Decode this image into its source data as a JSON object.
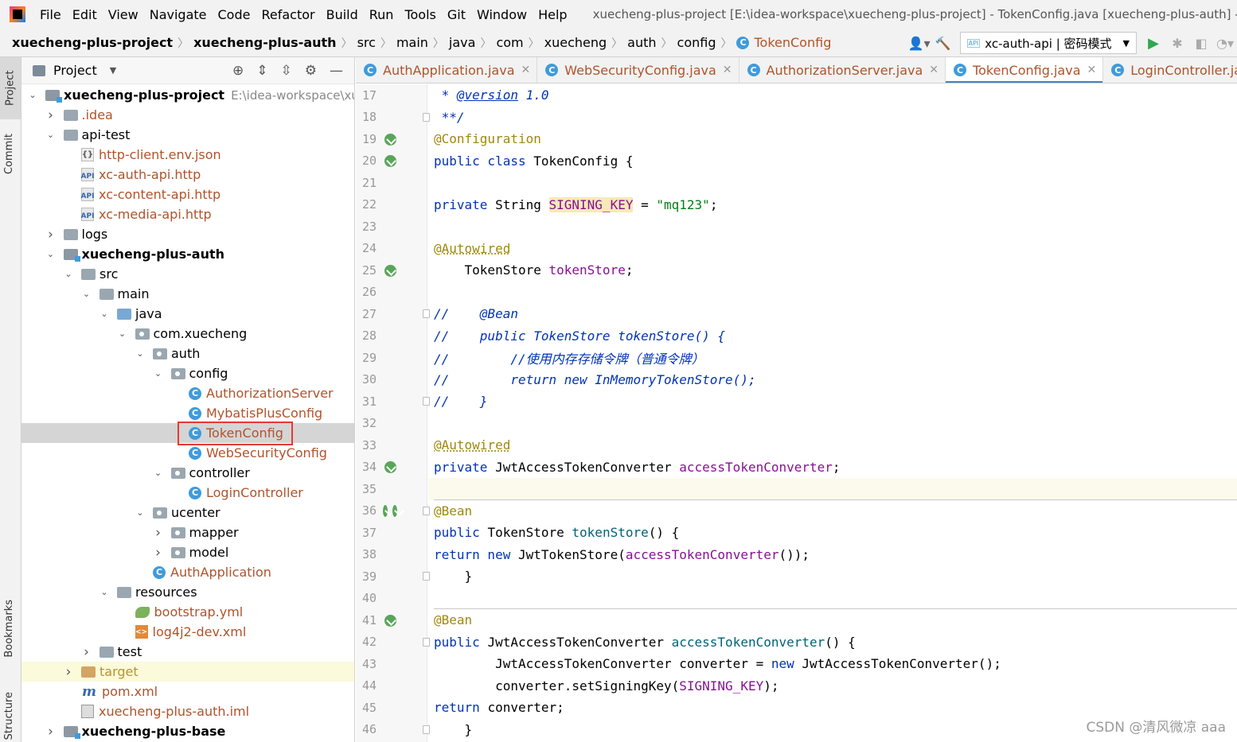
{
  "menu": {
    "items": [
      "File",
      "Edit",
      "View",
      "Navigate",
      "Code",
      "Refactor",
      "Build",
      "Run",
      "Tools",
      "Git",
      "Window",
      "Help"
    ],
    "window_title": "xuecheng-plus-project [E:\\idea-workspace\\xuecheng-plus-project] - TokenConfig.java [xuecheng-plus-auth] - A"
  },
  "breadcrumb": [
    "xuecheng-plus-project",
    "xuecheng-plus-auth",
    "src",
    "main",
    "java",
    "com",
    "xuecheng",
    "auth",
    "config",
    "TokenConfig"
  ],
  "toolbar": {
    "run_config": "xc-auth-api | 密码模式",
    "run_config_badge": "API"
  },
  "left_strip": [
    "Project",
    "Commit",
    "Bookmarks",
    "Structure"
  ],
  "project_panel": {
    "title": "Project",
    "tree": [
      {
        "label": "xuecheng-plus-project",
        "path": "E:\\idea-workspace\\xuecheng",
        "type": "module",
        "bold": true,
        "depth": 0,
        "open": true
      },
      {
        "label": ".idea",
        "type": "folder",
        "depth": 1,
        "open": false
      },
      {
        "label": "api-test",
        "type": "folder",
        "depth": 1,
        "open": true
      },
      {
        "label": "http-client.env.json",
        "type": "json",
        "depth": 2
      },
      {
        "label": "xc-auth-api.http",
        "type": "api",
        "depth": 2
      },
      {
        "label": "xc-content-api.http",
        "type": "api",
        "depth": 2
      },
      {
        "label": "xc-media-api.http",
        "type": "api",
        "depth": 2
      },
      {
        "label": "logs",
        "type": "folder",
        "depth": 1,
        "open": false
      },
      {
        "label": "xuecheng-plus-auth",
        "type": "module",
        "bold": true,
        "depth": 1,
        "open": true
      },
      {
        "label": "src",
        "type": "folder",
        "depth": 2,
        "open": true
      },
      {
        "label": "main",
        "type": "folder",
        "depth": 3,
        "open": true
      },
      {
        "label": "java",
        "type": "folder-blue",
        "depth": 4,
        "open": true
      },
      {
        "label": "com.xuecheng",
        "type": "package",
        "depth": 5,
        "open": true
      },
      {
        "label": "auth",
        "type": "package",
        "depth": 6,
        "open": true
      },
      {
        "label": "config",
        "type": "package",
        "depth": 7,
        "open": true
      },
      {
        "label": "AuthorizationServer",
        "type": "class",
        "depth": 8
      },
      {
        "label": "MybatisPlusConfig",
        "type": "class",
        "depth": 8
      },
      {
        "label": "TokenConfig",
        "type": "class",
        "depth": 8,
        "selected": true
      },
      {
        "label": "WebSecurityConfig",
        "type": "class",
        "depth": 8
      },
      {
        "label": "controller",
        "type": "package",
        "depth": 7,
        "open": true
      },
      {
        "label": "LoginController",
        "type": "class",
        "depth": 8
      },
      {
        "label": "ucenter",
        "type": "package",
        "depth": 6,
        "open": true
      },
      {
        "label": "mapper",
        "type": "package",
        "depth": 7,
        "open": false
      },
      {
        "label": "model",
        "type": "package",
        "depth": 7,
        "open": false
      },
      {
        "label": "AuthApplication",
        "type": "class",
        "depth": 6
      },
      {
        "label": "resources",
        "type": "resources",
        "depth": 4,
        "open": true
      },
      {
        "label": "bootstrap.yml",
        "type": "yml",
        "depth": 5
      },
      {
        "label": "log4j2-dev.xml",
        "type": "xml",
        "depth": 5
      },
      {
        "label": "test",
        "type": "folder",
        "depth": 3,
        "open": false
      },
      {
        "label": "target",
        "type": "target",
        "depth": 2,
        "open": false,
        "highlight": true
      },
      {
        "label": "pom.xml",
        "type": "pom",
        "depth": 2
      },
      {
        "label": "xuecheng-plus-auth.iml",
        "type": "iml",
        "depth": 2
      },
      {
        "label": "xuecheng-plus-base",
        "type": "module",
        "bold": true,
        "depth": 1,
        "open": false
      }
    ]
  },
  "editor": {
    "tabs": [
      {
        "label": "AuthApplication.java",
        "active": false
      },
      {
        "label": "WebSecurityConfig.java",
        "active": false
      },
      {
        "label": "AuthorizationServer.java",
        "active": false
      },
      {
        "label": "TokenConfig.java",
        "active": true
      },
      {
        "label": "LoginController.java",
        "active": false
      }
    ],
    "tab_overflow_badge": "API",
    "lines": [
      {
        "n": 17,
        "html": "<span class=\"cm\"> * </span><span class=\"cmtag\">@version</span><span class=\"cm\"> 1.0</span>"
      },
      {
        "n": 18,
        "html": "<span class=\"cm\"> **/</span>"
      },
      {
        "n": 19,
        "html": "<span class=\"an\">@Configuration</span>",
        "gutter": "bean"
      },
      {
        "n": 20,
        "html": "<span class=\"kw\">public class </span>TokenConfig {",
        "gutter": "bean"
      },
      {
        "n": 21,
        "html": ""
      },
      {
        "n": 22,
        "html": "    <span class=\"kw\">private </span>String <span class=\"sk\">SIGNING_KEY</span> = <span class=\"str\">\"mq123\"</span>;"
      },
      {
        "n": 23,
        "html": ""
      },
      {
        "n": 24,
        "html": "    <span class=\"anu\">@Autowired</span>"
      },
      {
        "n": 25,
        "html": "    TokenStore <span class=\"fld\">tokenStore</span>;",
        "gutter": "bean"
      },
      {
        "n": 26,
        "html": ""
      },
      {
        "n": 27,
        "html": "<span class=\"cmi\">//    @Bean</span>"
      },
      {
        "n": 28,
        "html": "<span class=\"cmi\">//    public TokenStore tokenStore() {</span>"
      },
      {
        "n": 29,
        "html": "<span class=\"cmi\">//        //使用内存存储令牌（普通令牌）</span>"
      },
      {
        "n": 30,
        "html": "<span class=\"cmi\">//        return new InMemoryTokenStore();</span>"
      },
      {
        "n": 31,
        "html": "<span class=\"cmi\">//    }</span>"
      },
      {
        "n": 32,
        "html": ""
      },
      {
        "n": 33,
        "html": "    <span class=\"anu\">@Autowired</span>"
      },
      {
        "n": 34,
        "html": "    <span class=\"kw\">private </span>JwtAccessTokenConverter <span class=\"fld\">accessTokenConverter</span>;",
        "gutter": "bean"
      },
      {
        "n": 35,
        "html": "",
        "current": true
      },
      {
        "n": 36,
        "html": "    <span class=\"an\">@Bean</span>",
        "gutter": "bean2"
      },
      {
        "n": 37,
        "html": "    <span class=\"kw\">public </span>TokenStore <span class=\"mth\">tokenStore</span>() {"
      },
      {
        "n": 38,
        "html": "        <span class=\"kw\">return new </span>JwtTokenStore(<span class=\"fld\">accessTokenConverter</span>());"
      },
      {
        "n": 39,
        "html": "    }"
      },
      {
        "n": 40,
        "html": ""
      },
      {
        "n": 41,
        "html": "    <span class=\"an\">@Bean</span>",
        "gutter": "bean"
      },
      {
        "n": 42,
        "html": "    <span class=\"kw\">public </span>JwtAccessTokenConverter <span class=\"mth\">accessTokenConverter</span>() {"
      },
      {
        "n": 43,
        "html": "        JwtAccessTokenConverter converter = <span class=\"kw\">new </span>JwtAccessTokenConverter();"
      },
      {
        "n": 44,
        "html": "        converter.setSigningKey(<span class=\"fld\">SIGNING_KEY</span>);"
      },
      {
        "n": 45,
        "html": "        <span class=\"kw\">return </span>converter;"
      },
      {
        "n": 46,
        "html": "    }"
      }
    ]
  },
  "watermark": "CSDN @清风微凉 aaa"
}
